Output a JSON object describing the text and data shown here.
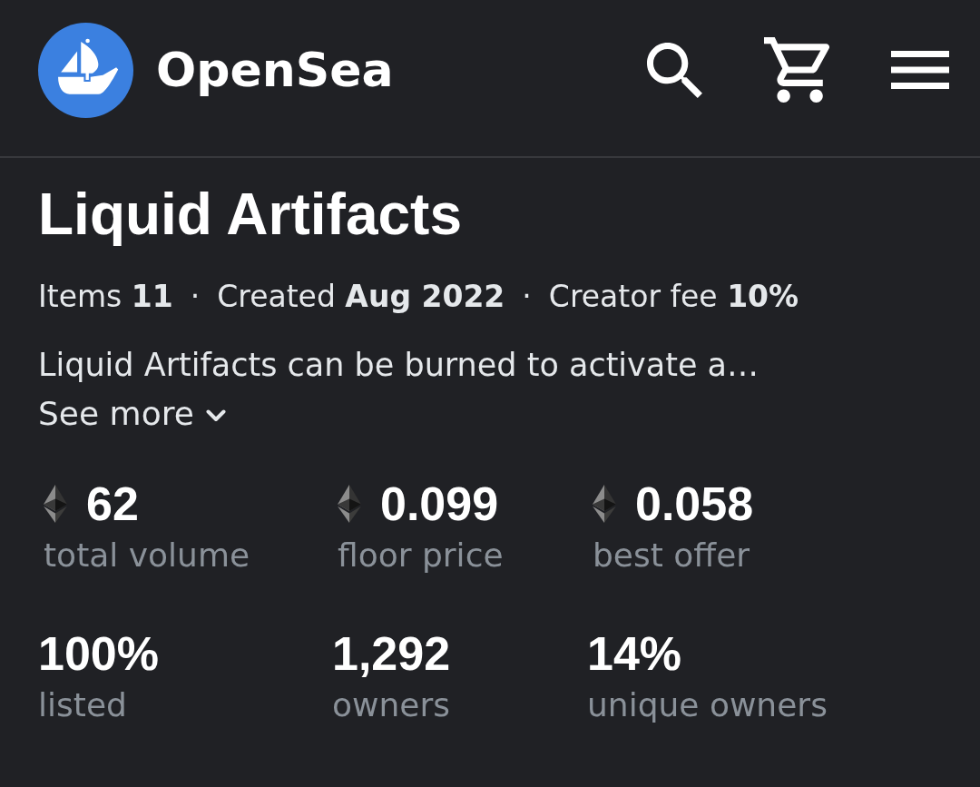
{
  "header": {
    "brand": "OpenSea",
    "actions": [
      {
        "kind": "search"
      },
      {
        "kind": "cart"
      },
      {
        "kind": "menu"
      }
    ]
  },
  "collection": {
    "title": "Liquid Artifacts",
    "meta": [
      {
        "kind": "fact",
        "label": "Items",
        "value": "11"
      },
      {
        "kind": "separator",
        "text": "·"
      },
      {
        "kind": "fact",
        "label": "Created",
        "value": "Aug 2022"
      },
      {
        "kind": "separator",
        "text": "·"
      },
      {
        "kind": "fact",
        "label": "Creator fee",
        "value": "10%"
      }
    ],
    "description": "Liquid Artifacts can be burned to activate a…",
    "see_more": "See more"
  },
  "stats": [
    {
      "kind": "price",
      "value": "62",
      "label": "total volume"
    },
    {
      "kind": "price",
      "value": "0.099",
      "label": "floor price"
    },
    {
      "kind": "price",
      "value": "0.058",
      "label": "best offer"
    },
    {
      "kind": "count",
      "value": "100%",
      "label": "listed"
    },
    {
      "kind": "count",
      "value": "1,292",
      "label": "owners"
    },
    {
      "kind": "count",
      "value": "14%",
      "label": "unique owners"
    }
  ]
}
